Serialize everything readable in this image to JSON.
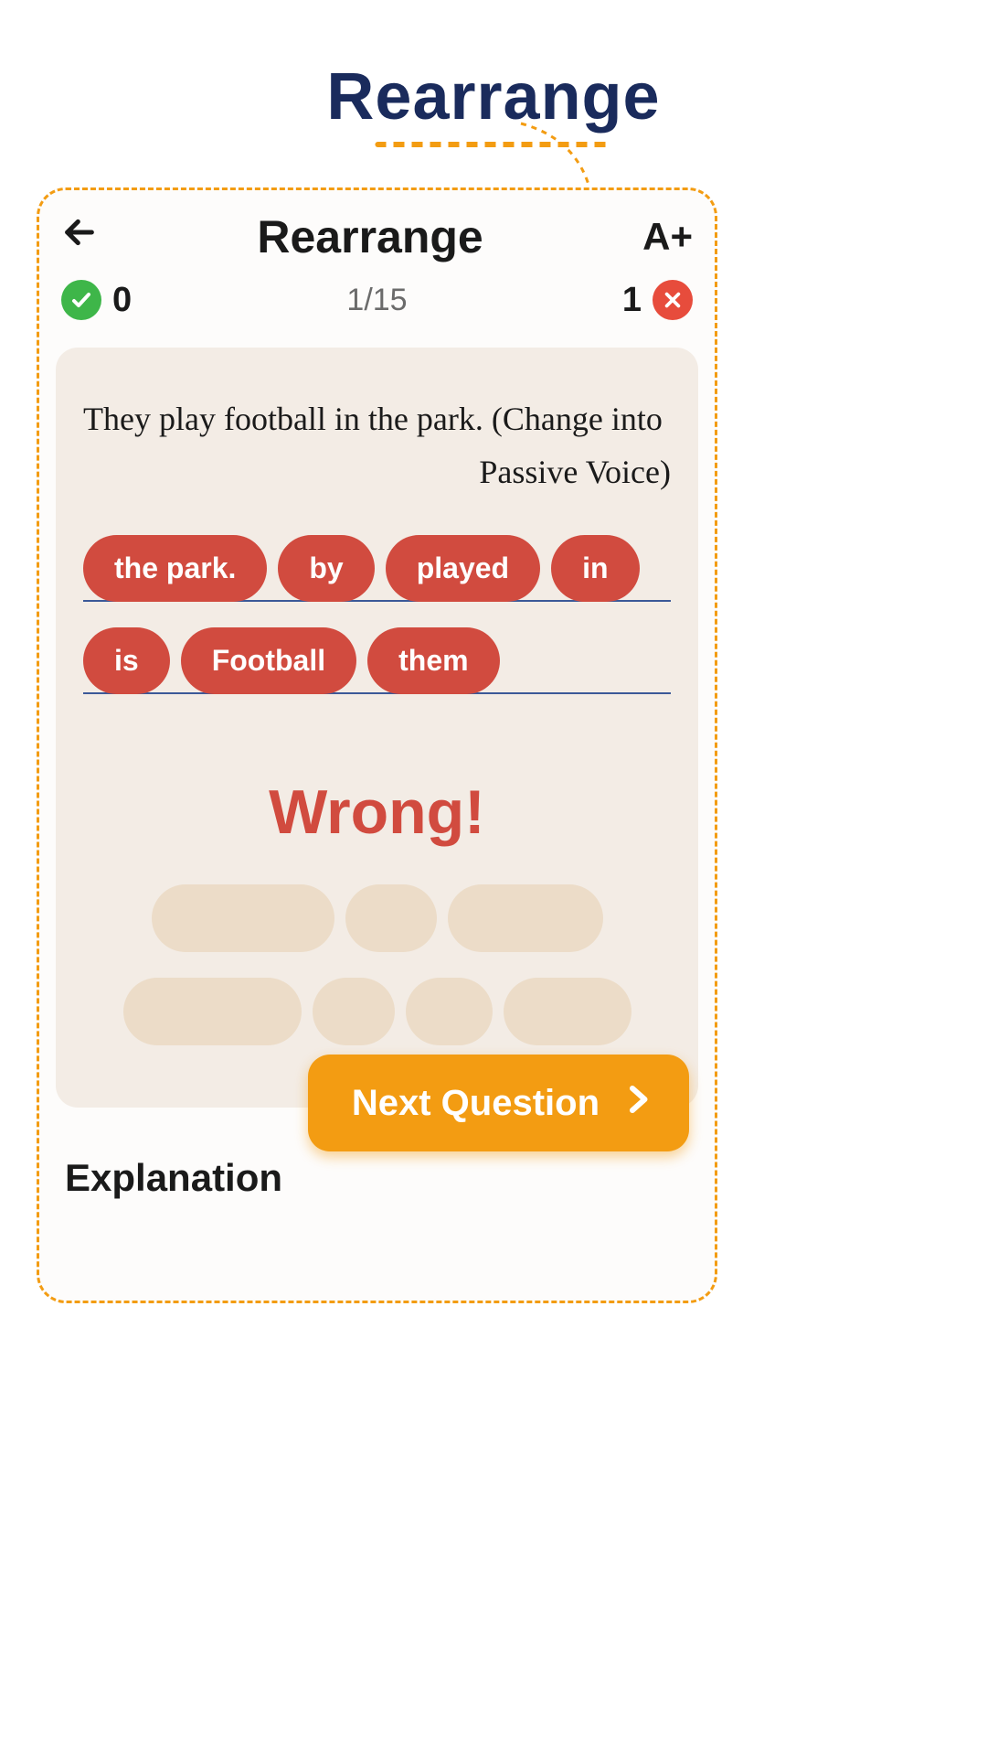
{
  "page": {
    "title": "Rearrange"
  },
  "header": {
    "title": "Rearrange",
    "font_button": "A+"
  },
  "score": {
    "correct": "0",
    "progress": "1/15",
    "wrong": "1"
  },
  "question": {
    "line1": "They play football in the park. (Change into",
    "line2": "Passive Voice)"
  },
  "chips": {
    "row1": [
      "the park.",
      "by",
      "played",
      "in"
    ],
    "row2": [
      "is",
      "Football",
      "them"
    ]
  },
  "result": "Wrong!",
  "buttons": {
    "next": "Next Question"
  },
  "labels": {
    "explanation": "Explanation"
  }
}
